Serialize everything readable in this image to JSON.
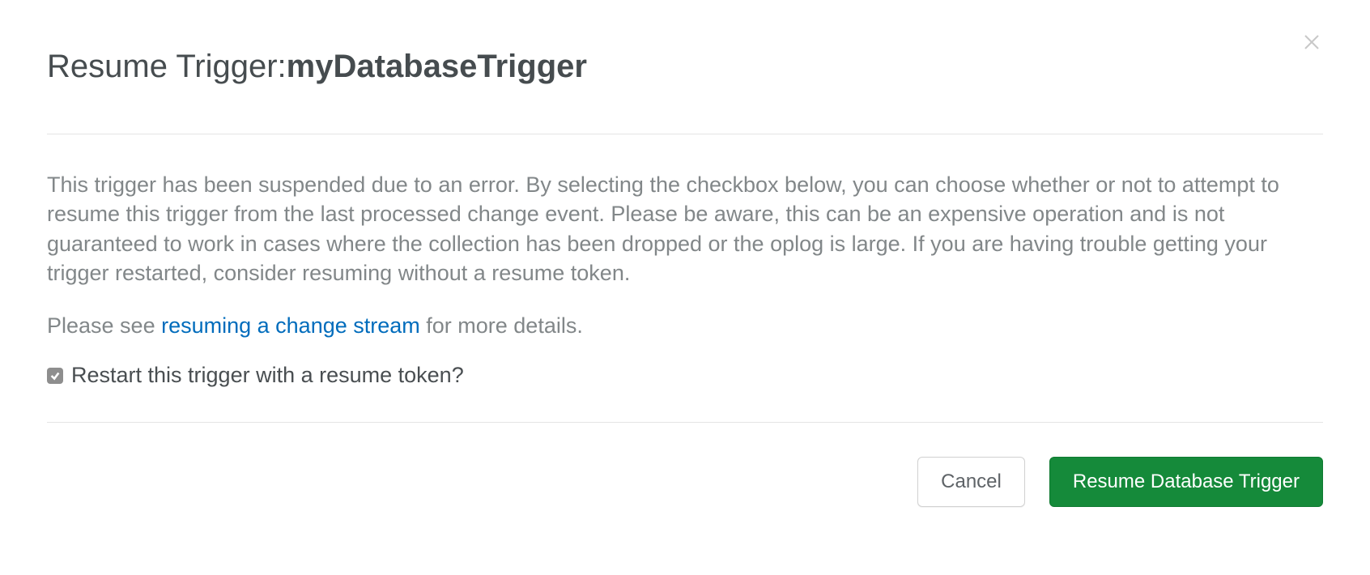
{
  "header": {
    "title_prefix": "Resume Trigger: ",
    "trigger_name": "myDatabaseTrigger"
  },
  "body": {
    "paragraph1": "This trigger has been suspended due to an error. By selecting the checkbox below, you can choose whether or not to attempt to resume this trigger from the last processed change event. Please be aware, this can be an expensive operation and is not guaranteed to work in cases where the collection has been dropped or the oplog is large. If you are having trouble getting your trigger restarted, consider resuming without a resume token.",
    "paragraph2_prefix": "Please see ",
    "paragraph2_link": "resuming a change stream",
    "paragraph2_suffix": " for more details."
  },
  "checkbox": {
    "label": "Restart this trigger with a resume token?",
    "checked": true
  },
  "footer": {
    "cancel_label": "Cancel",
    "primary_label": "Resume Database Trigger"
  },
  "colors": {
    "primary_green": "#158a3a",
    "link_blue": "#006cbc",
    "text_gray": "#828789",
    "heading_gray": "#464c4f"
  }
}
